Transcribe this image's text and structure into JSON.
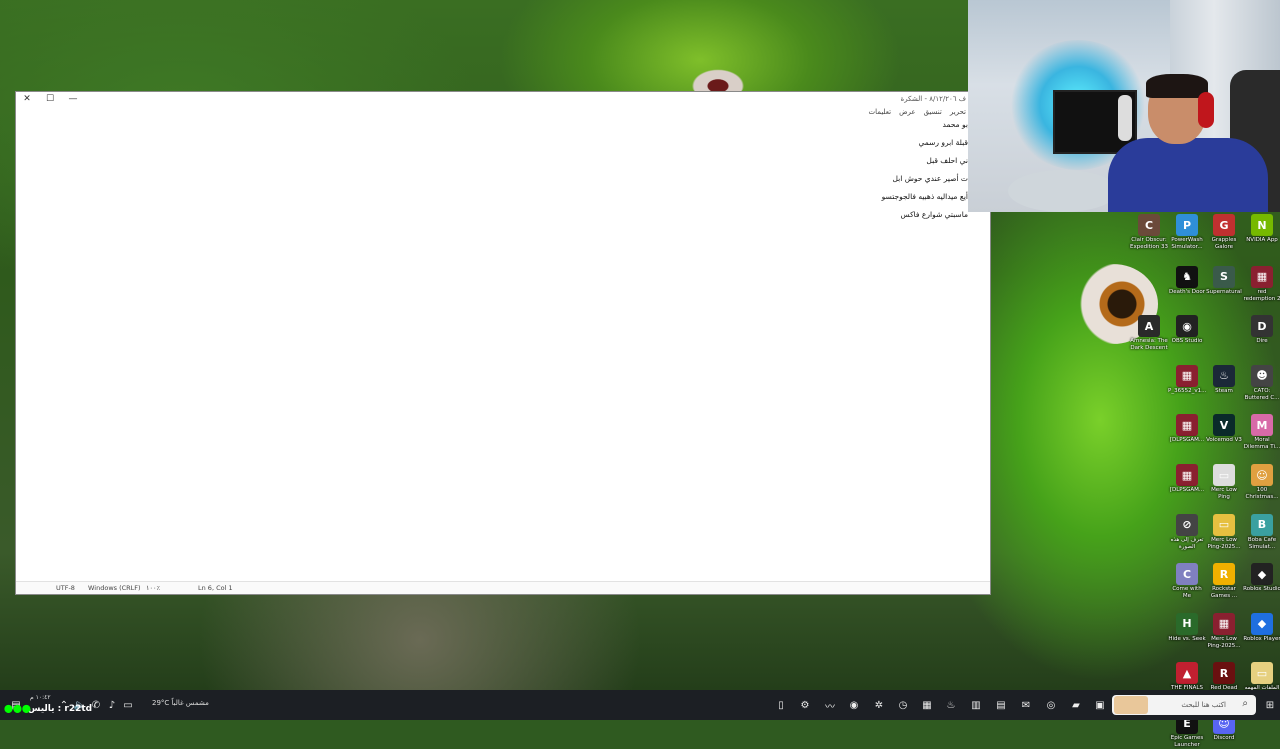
{
  "notepad": {
    "title": "ف ٨/١٢/٢٠٦ - الشكرة",
    "menus": [
      "تحرير",
      "تنسيق",
      "عرض",
      "تعليمات"
    ],
    "lines": [
      "بو محمد",
      "قبلة ابرو رسمي",
      "ني احلف قبل",
      "ت أصير عندي حوش ابل",
      "أيع ميداليه ذهبيه فالجوجتسو",
      "ماسبتي شوارع فاكس"
    ],
    "status": {
      "encoding": "UTF-8",
      "line_endings": "Windows (CRLF)",
      "zoom": "١٠٠٪",
      "position": "Ln 6, Col 1"
    },
    "window_buttons": {
      "close": "✕",
      "maximize": "☐",
      "minimize": "—"
    }
  },
  "desktop_icons": [
    {
      "label": "Clair Obscur: Expedition 33",
      "glyph": "C",
      "color": "#6b4a3a"
    },
    {
      "label": "PowerWash Simulator...",
      "glyph": "P",
      "color": "#2f8fd8"
    },
    {
      "label": "Grapples Galore",
      "glyph": "G",
      "color": "#c03030"
    },
    {
      "label": "NVIDIA App",
      "glyph": "N",
      "color": "#76b900"
    },
    {
      "label": "Death's Door",
      "glyph": "♞",
      "color": "#111111"
    },
    {
      "label": "Supernatural",
      "glyph": "S",
      "color": "#3a5a4a"
    },
    {
      "label": "red redemption 2",
      "glyph": "▦",
      "color": "#8a2030"
    },
    {
      "label": "OBS Studio",
      "glyph": "◉",
      "color": "#222222"
    },
    {
      "label": "Amnesia: The Dark Descent",
      "glyph": "A",
      "color": "#2a2a2a"
    },
    {
      "label": "Dire",
      "glyph": "D",
      "color": "#333333"
    },
    {
      "label": "P_36552_v1...",
      "glyph": "▦",
      "color": "#8a2030"
    },
    {
      "label": "Steam",
      "glyph": "♨",
      "color": "#1b2838"
    },
    {
      "label": "CATO: Buttered C...",
      "glyph": "☻",
      "color": "#444444"
    },
    {
      "label": "[DLPSGAM...",
      "glyph": "▦",
      "color": "#8a2030"
    },
    {
      "label": "Voicemod V3",
      "glyph": "V",
      "color": "#0a2a2a"
    },
    {
      "label": "Moral Dilemma Ti...",
      "glyph": "M",
      "color": "#d86aa8"
    },
    {
      "label": "[DLPSGAM...",
      "glyph": "▦",
      "color": "#8a2030"
    },
    {
      "label": "Merc Low Ping",
      "glyph": "▭",
      "color": "#dddddd"
    },
    {
      "label": "100 Christmas...",
      "glyph": "☺",
      "color": "#e0a040"
    },
    {
      "label": "تعرف إلى هذه الصورة",
      "glyph": "⊘",
      "color": "#444444"
    },
    {
      "label": "Merc Low Ping-2025...",
      "glyph": "▭",
      "color": "#e6c040"
    },
    {
      "label": "Boba Cafe Simulat...",
      "glyph": "B",
      "color": "#3aa0a0"
    },
    {
      "label": "Come with Me",
      "glyph": "C",
      "color": "#8080c0"
    },
    {
      "label": "Rockstar Games ...",
      "glyph": "R",
      "color": "#f0b000"
    },
    {
      "label": "Roblox Studio",
      "glyph": "◆",
      "color": "#222222"
    },
    {
      "label": "Hide vs. Seek",
      "glyph": "H",
      "color": "#2a6a2a"
    },
    {
      "label": "Merc Low Ping-2025...",
      "glyph": "▦",
      "color": "#8a2030"
    },
    {
      "label": "Roblox Player",
      "glyph": "◆",
      "color": "#1f6fe0"
    },
    {
      "label": "THE FINALS",
      "glyph": "▲",
      "color": "#c02030"
    },
    {
      "label": "Red Dead Redempti...",
      "glyph": "R",
      "color": "#6a1010"
    },
    {
      "label": "الملفات المهمه",
      "glyph": "▭",
      "color": "#e6d080"
    },
    {
      "label": "Epic Games Launcher",
      "glyph": "E",
      "color": "#111111"
    },
    {
      "label": "Discord",
      "glyph": "☺",
      "color": "#5865f2"
    }
  ],
  "taskbar": {
    "search_placeholder": "اكتب هنا للبحث",
    "weather": "29°C مشمس غالباً",
    "overlay_name": "r22td : ياليس",
    "clock": "١٠:٤٢ م"
  }
}
